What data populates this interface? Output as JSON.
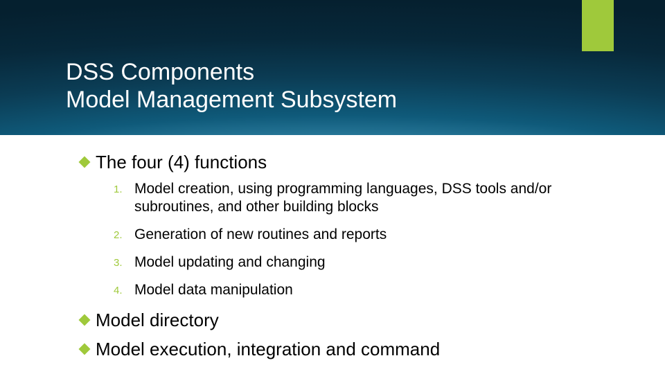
{
  "accent_color": "#9fc93b",
  "title": {
    "line1": "DSS Components",
    "line2": "Model Management Subsystem"
  },
  "bullets": {
    "b1": "The four (4) functions",
    "b2": "Model directory",
    "b3": "Model execution, integration and command"
  },
  "numbered": {
    "n1_marker": "1.",
    "n1_text": "Model creation, using programming languages, DSS tools and/or subroutines, and other building blocks",
    "n2_marker": "2.",
    "n2_text": "Generation of new routines and reports",
    "n3_marker": "3.",
    "n3_text": "Model updating and changing",
    "n4_marker": "4.",
    "n4_text": "Model data manipulation"
  }
}
